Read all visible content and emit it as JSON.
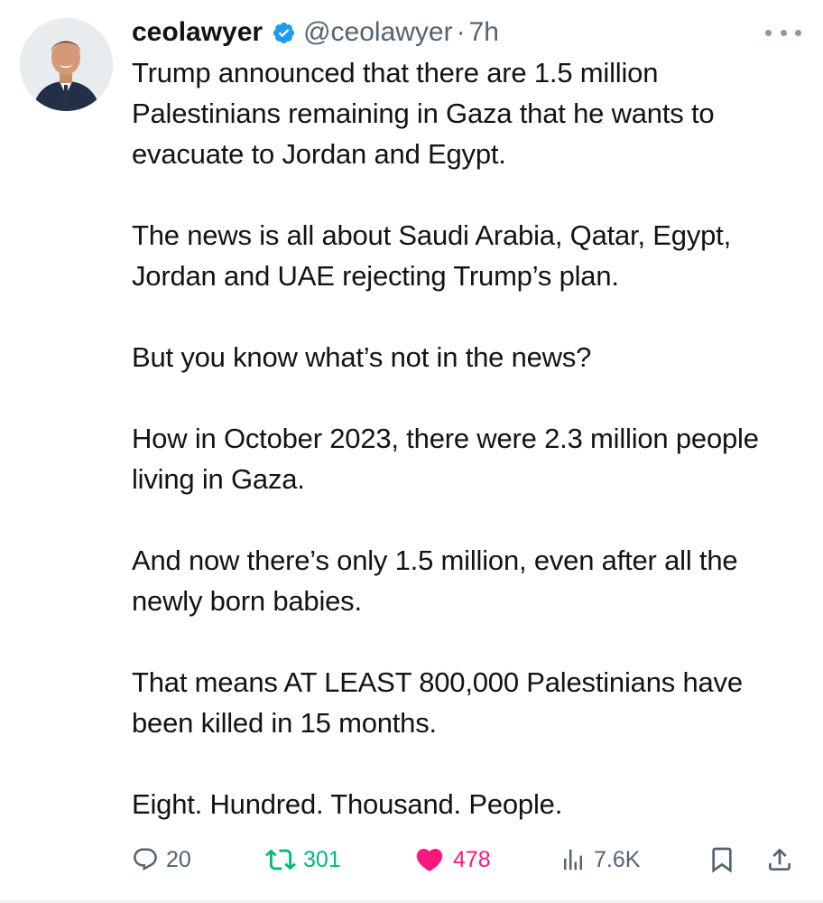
{
  "user": {
    "display_name": "ceolawyer",
    "handle": "@ceolawyer",
    "separator": "·",
    "time": "7h",
    "verified": true
  },
  "tweet": {
    "paragraphs": [
      "Trump announced that there are 1.5 million Palestinians remaining in Gaza that he wants to evacuate to Jordan and Egypt.",
      "The news is all about Saudi Arabia, Qatar, Egypt, Jordan and UAE rejecting Trump’s plan.",
      "But you know what’s not in the news?",
      "How in October 2023, there were 2.3 million people living in Gaza.",
      "And now there’s only 1.5 million, even after all the newly born babies.",
      "That means AT LEAST 800,000 Palestinians have been killed in 15 months.",
      "Eight. Hundred. Thousand. People."
    ]
  },
  "actions": {
    "replies": "20",
    "retweets": "301",
    "likes": "478",
    "views": "7.6K",
    "liked": true
  },
  "icons": {
    "avatar": "avatar-photo",
    "verified": "verified-badge-icon",
    "more": "more-icon",
    "reply": "reply-icon",
    "retweet": "retweet-icon",
    "like": "heart-icon",
    "views": "views-icon",
    "bookmark": "bookmark-icon",
    "share": "share-icon"
  },
  "colors": {
    "text": "#0f1419",
    "secondary": "#536471",
    "verified": "#1d9bf0",
    "retweet": "#00ba7c",
    "like": "#f91880"
  }
}
